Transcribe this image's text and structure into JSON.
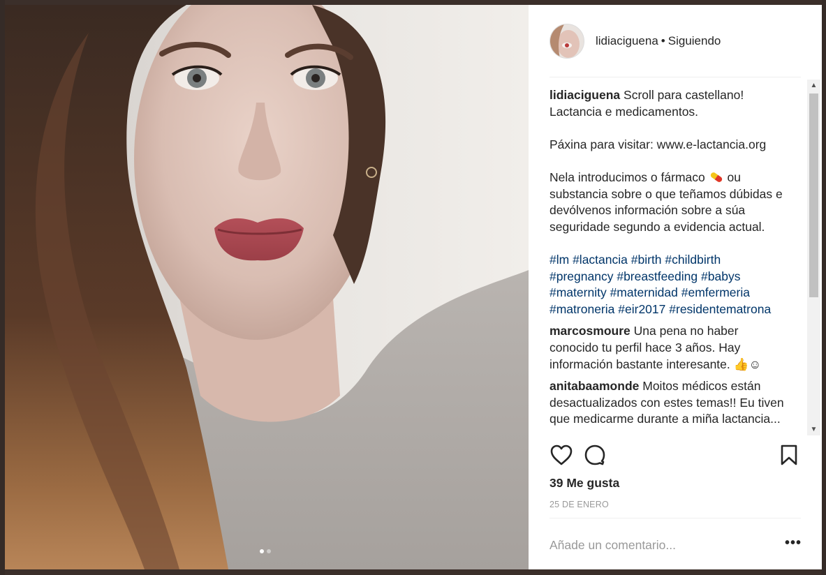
{
  "post": {
    "username": "lidiaciguena",
    "separator": "•",
    "follow_status": "Siguiendo",
    "caption_user": "lidiaciguena",
    "caption_lines": [
      "Scroll para castellano!",
      "Lactancia e medicamentos.",
      "",
      "Páxina para visitar: www.e-lactancia.org",
      "",
      "Nela introducimos o fármaco",
      "ou",
      "substancia sobre o que teñamos dúbidas e devólvenos información sobre a súa seguridade segundo a evidencia actual."
    ],
    "hashtags": [
      "#lm",
      "#lactancia",
      "#birth",
      "#childbirth",
      "#pregnancy",
      "#breastfeeding",
      "#babys",
      "#maternity",
      "#maternidad",
      "#emfermeria",
      "#matroneria",
      "#eir2017",
      "#residentematrona"
    ],
    "comments": [
      {
        "user": "marcosmoure",
        "text": "Una pena no haber conocido tu perfil hace 3 años. Hay información bastante interesante. 👍☺"
      },
      {
        "user": "anitabaamonde",
        "text": "Moitos médicos están desactualizados con estes temas!! Eu tiven que medicarme durante a miña lactancia..."
      }
    ],
    "likes_text": "39 Me gusta",
    "date_text": "25 DE ENERO",
    "comment_placeholder": "Añade un comentario...",
    "more_label": "•••",
    "carousel": {
      "total": 2,
      "active": 1
    }
  },
  "icons": {
    "like": "heart-icon",
    "comment": "comment-bubble-icon",
    "save": "bookmark-icon",
    "pill": "pill-emoji-icon",
    "scroll_up": "scroll-up-arrow-icon",
    "scroll_down": "scroll-down-arrow-icon"
  },
  "colors": {
    "hashtag": "#003569",
    "text": "#262626",
    "muted": "#999999"
  }
}
